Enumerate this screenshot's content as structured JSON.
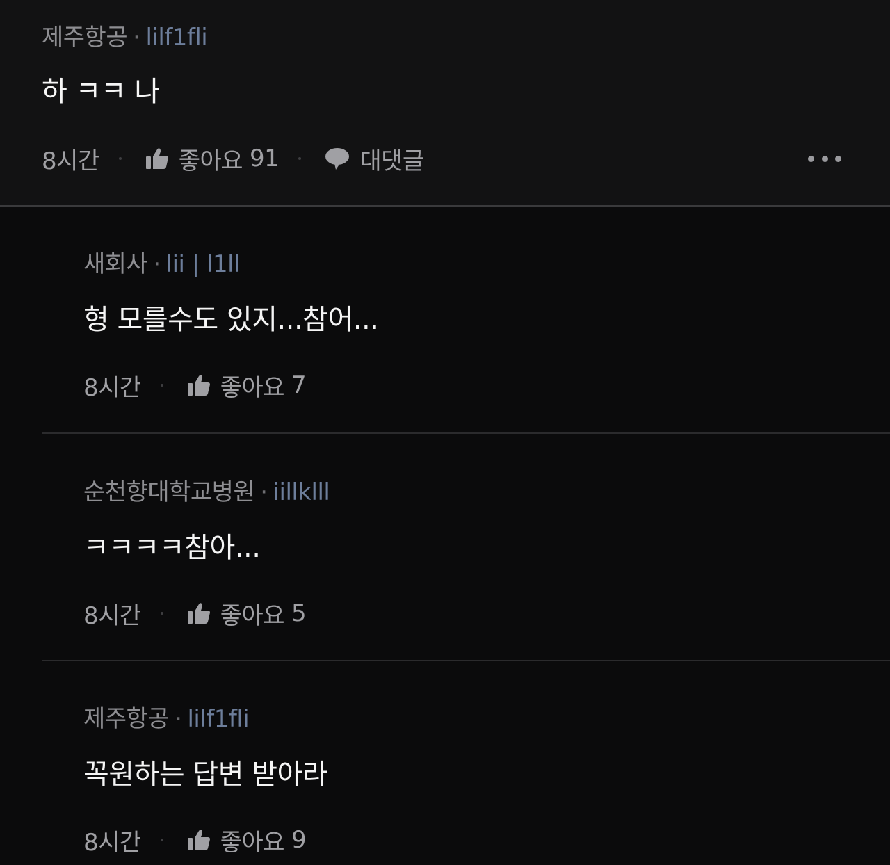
{
  "comments": [
    {
      "author": "제주항공",
      "handle": "lilf1fli",
      "text": "하 ㅋㅋ 나",
      "time": "8시간",
      "like_label": "좋아요",
      "like_count": "91",
      "reply_label": "대댓글"
    },
    {
      "author": "새회사",
      "handle": "lii | l1ll",
      "text": "형 모를수도 있지...참어...",
      "time": "8시간",
      "like_label": "좋아요",
      "like_count": "7"
    },
    {
      "author": "순천향대학교병원",
      "handle": "iillklll",
      "text": "ㅋㅋㅋㅋ참아...",
      "time": "8시간",
      "like_label": "좋아요",
      "like_count": "5"
    },
    {
      "author": "제주항공",
      "handle": "lilf1fli",
      "text": "꼭원하는 답변 받아라",
      "time": "8시간",
      "like_label": "좋아요",
      "like_count": "9"
    }
  ],
  "icons": {
    "like": "thumbs-up-icon",
    "reply": "speech-bubble-icon",
    "more": "more-dots-icon"
  },
  "colors": {
    "background": "#0b0b0c",
    "top_comment_background": "#121213",
    "author": "#8e8e92",
    "handle": "#6d7e9b",
    "body_text": "#f5f5f5",
    "action_text": "#a0a0a4"
  }
}
